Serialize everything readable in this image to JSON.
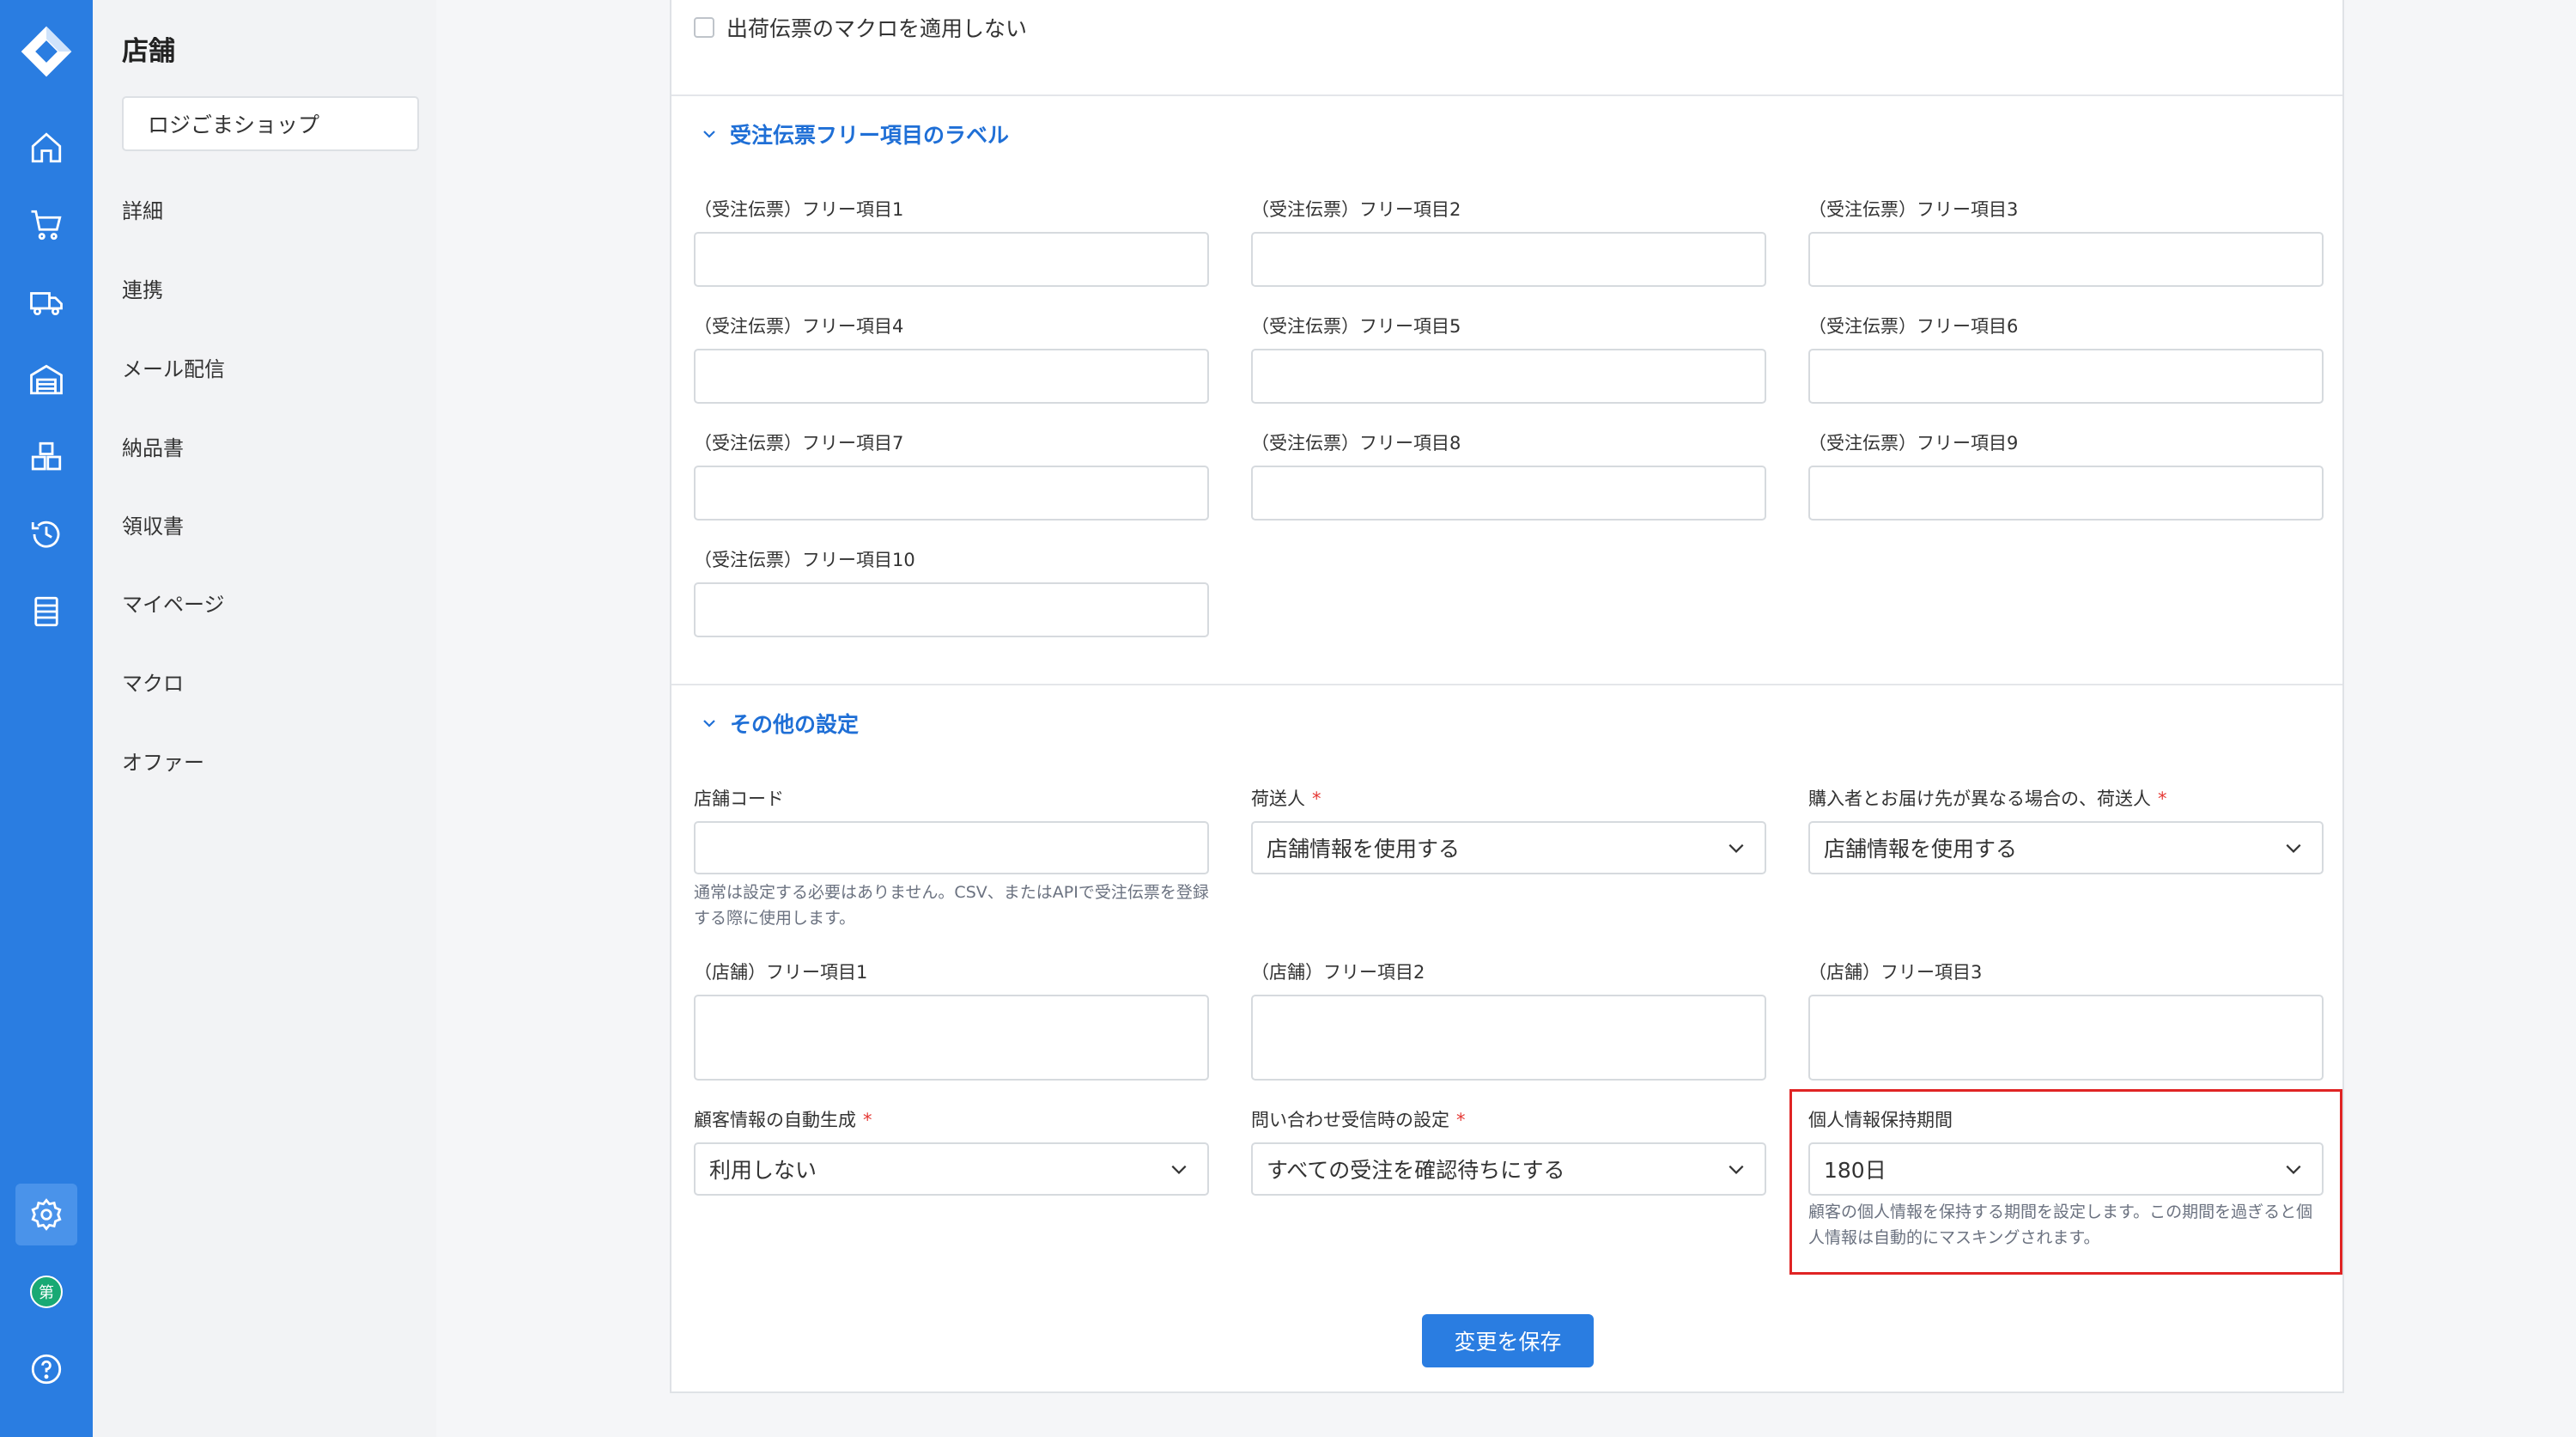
{
  "sidebar_title": "店舗",
  "shop_name": "ロジごまショップ",
  "subnav": [
    "詳細",
    "連携",
    "メール配信",
    "納品書",
    "領収書",
    "マイページ",
    "マクロ",
    "オファー"
  ],
  "checkbox_label": "出荷伝票のマクロを適用しない",
  "section_labels": {
    "title": "受注伝票フリー項目のラベル",
    "fields": [
      "（受注伝票）フリー項目1",
      "（受注伝票）フリー項目2",
      "（受注伝票）フリー項目3",
      "（受注伝票）フリー項目4",
      "（受注伝票）フリー項目5",
      "（受注伝票）フリー項目6",
      "（受注伝票）フリー項目7",
      "（受注伝票）フリー項目8",
      "（受注伝票）フリー項目9",
      "（受注伝票）フリー項目10"
    ]
  },
  "section_other": {
    "title": "その他の設定",
    "store_code_label": "店舗コード",
    "store_code_help": "通常は設定する必要はありません。CSV、またはAPIで受注伝票を登録する際に使用します。",
    "shipper_label": "荷送人",
    "shipper_value": "店舗情報を使用する",
    "shipper_diff_label": "購入者とお届け先が異なる場合の、荷送人",
    "shipper_diff_value": "店舗情報を使用する",
    "store_free": [
      "（店舗）フリー項目1",
      "（店舗）フリー項目2",
      "（店舗）フリー項目3"
    ],
    "customer_auto_label": "顧客情報の自動生成",
    "customer_auto_value": "利用しない",
    "inquiry_label": "問い合わせ受信時の設定",
    "inquiry_value": "すべての受注を確認待ちにする",
    "retention_label": "個人情報保持期間",
    "retention_value": "180日",
    "retention_help": "顧客の個人情報を保持する期間を設定します。この期間を過ぎると個人情報は自動的にマスキングされます。",
    "required_mark": "*"
  },
  "save_label": "変更を保存",
  "rail_badge": "第"
}
